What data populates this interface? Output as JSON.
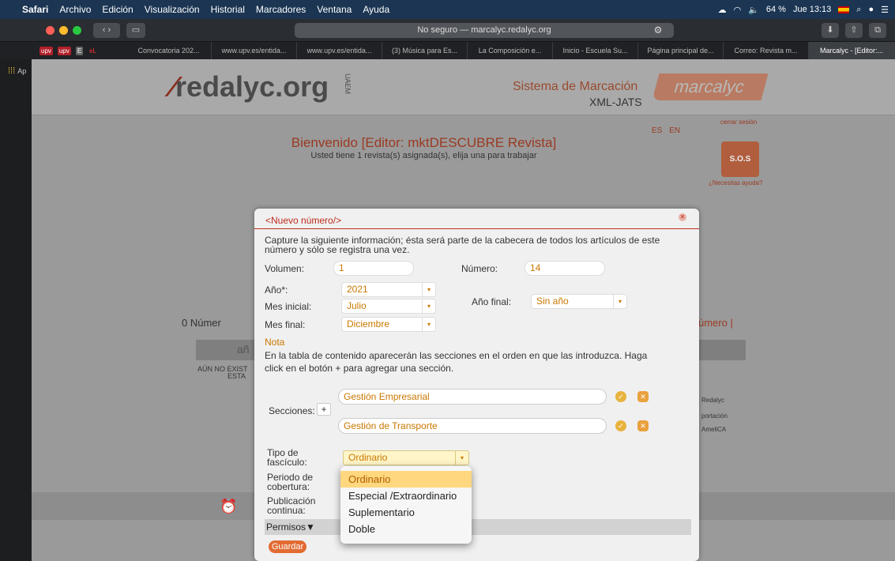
{
  "menubar": {
    "app": "Safari",
    "items": [
      "Archivo",
      "Edición",
      "Visualización",
      "Historial",
      "Marcadores",
      "Ventana",
      "Ayuda"
    ],
    "battery": "64 %",
    "clock": "Jue 13:13"
  },
  "browser": {
    "url": "No seguro — marcalyc.redalyc.org",
    "tabs": [
      "Convocatoria 202...",
      "www.upv.es/entida...",
      "www.upv.es/entida...",
      "(3) Música para Es...",
      "La Composición e...",
      "Inicio - Escuela Su...",
      "Página principal de...",
      "Correo: Revista m...",
      "Marcalyc - [Editor:..."
    ],
    "favorites": [
      "upv",
      "upv",
      "E",
      "eL"
    ],
    "sidebar_label": "Ap"
  },
  "header": {
    "logo": "redalyc.org",
    "uaem": "UAEM",
    "sistema": "Sistema de Marcación",
    "xml": "XML-JATS",
    "marcalyc": "marcalyc",
    "lang": "ES EN",
    "logout": "cerrar sesión",
    "welcome": "Bienvenido [Editor: mktDESCUBRE Revista]",
    "welcome_sub": "Usted tiene 1 revista(s) asignada(s), elija una para trabajar",
    "sos": "S.O.S",
    "help": "¿Necesitas ayuda?"
  },
  "background": {
    "numero_left": "0 Númer",
    "numero_right": "úmero |",
    "ano": "añ",
    "aun_no": "AÚN NO EXIST",
    "esta": "ESTA",
    "redalyc": "Redalyc",
    "portacion": "portación",
    "amelica": "AmeliCA"
  },
  "modal": {
    "title": "<Nuevo número/>",
    "intro": "Capture la siguiente información; ésta será parte de la cabecera de todos los artículos de este número y sólo se registra una vez.",
    "volumen_label": "Volumen:",
    "volumen_value": "1",
    "numero_label": "Número:",
    "numero_value": "14",
    "ano_label": "Año*:",
    "ano_value": "2021",
    "mes_inicial_label": "Mes inicial:",
    "mes_inicial_value": "Julio",
    "ano_final_label": "Año final:",
    "ano_final_value": "Sin año",
    "mes_final_label": "Mes final:",
    "mes_final_value": "Diciembre",
    "nota_label": "Nota",
    "nota_text": "En la tabla de contenido aparecerán las secciones en el orden en que las introduzca. Haga click en el botón + para agregar una sección.",
    "secciones_label": "Secciones:",
    "secciones": [
      "Gestión Empresarial",
      "Gestión de Transporte"
    ],
    "tipo_label": "Tipo de fascículo:",
    "tipo_value": "Ordinario",
    "periodo_label": "Periodo de cobertura:",
    "publicacion_label": "Publicación continua:",
    "permisos": "Permisos▼",
    "guardar": "Guardar"
  },
  "dropdown": {
    "options": [
      "Ordinario",
      "Especial /Extraordinario",
      "Suplementario",
      "Doble"
    ],
    "selected": "Ordinario"
  }
}
